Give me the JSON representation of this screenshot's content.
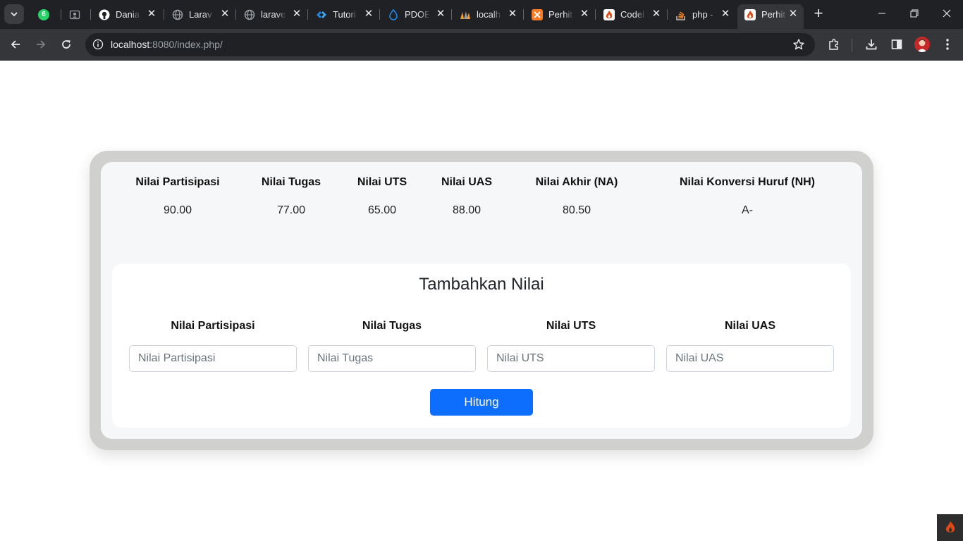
{
  "browser": {
    "tabs": [
      {
        "title": "",
        "icon": "whatsapp-icon",
        "badge": "6",
        "color": "#25d366"
      },
      {
        "title": "",
        "icon": "contact-card-icon",
        "color": "#9aa0a6"
      },
      {
        "title": "Dania",
        "icon": "github-icon",
        "color": "#ffffff"
      },
      {
        "title": "Larav",
        "icon": "globe-icon",
        "color": "#9aa0a6"
      },
      {
        "title": "larave",
        "icon": "globe-icon",
        "color": "#9aa0a6"
      },
      {
        "title": "Tutori",
        "icon": "tutorial-diamond-icon",
        "color": "#1e88e5"
      },
      {
        "title": "PDOE",
        "icon": "drupal-drop-icon",
        "color": "#1e88e5"
      },
      {
        "title": "localh",
        "icon": "phpmyadmin-icon",
        "color": "#f0a030"
      },
      {
        "title": "Perhit",
        "icon": "xampp-icon",
        "color": "#fb7a24"
      },
      {
        "title": "Codel",
        "icon": "codeigniter-icon",
        "color": "#dd4814"
      },
      {
        "title": "php -",
        "icon": "stackoverflow-icon",
        "color": "#f48024"
      },
      {
        "title": "Perhit",
        "icon": "codeigniter-icon",
        "color": "#dd4814",
        "active": true
      }
    ],
    "url_host": "localhost",
    "url_rest": ":8080/index.php/"
  },
  "results": {
    "headers": [
      "Nilai Partisipasi",
      "Nilai Tugas",
      "Nilai UTS",
      "Nilai UAS",
      "Nilai Akhir (NA)",
      "Nilai Konversi Huruf (NH)"
    ],
    "values": [
      "90.00",
      "77.00",
      "65.00",
      "88.00",
      "80.50",
      "A-"
    ]
  },
  "form": {
    "title": "Tambahkan Nilai",
    "fields": [
      {
        "label": "Nilai Partisipasi",
        "placeholder": "Nilai Partisipasi"
      },
      {
        "label": "Nilai Tugas",
        "placeholder": "Nilai Tugas"
      },
      {
        "label": "Nilai UTS",
        "placeholder": "Nilai UTS"
      },
      {
        "label": "Nilai UAS",
        "placeholder": "Nilai UAS"
      }
    ],
    "submit_label": "Hitung"
  },
  "colors": {
    "primary": "#0d6efd",
    "card_border": "#d0d0ce",
    "card_bg": "#f6f7f8"
  }
}
